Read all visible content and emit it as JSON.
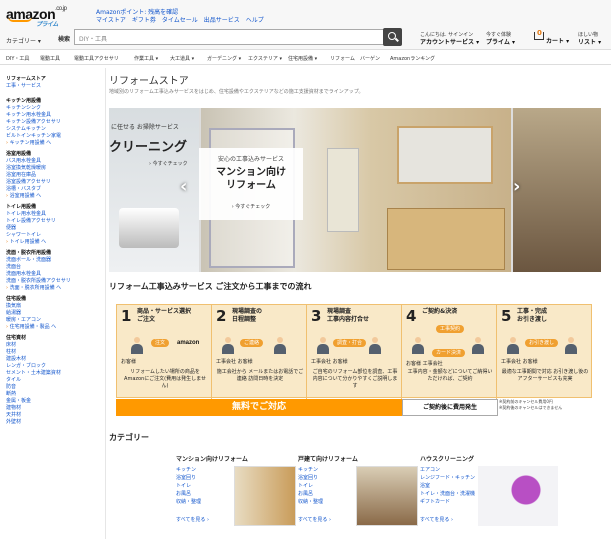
{
  "header": {
    "logo": "amazon",
    "logo_suffix": ".co.jp",
    "prime": "プライム",
    "promo": "Amazonポイント: 残高を確認",
    "toplinks": [
      "マイストア",
      "ギフト券",
      "タイムセール",
      "出品サービス",
      "ヘルプ"
    ],
    "category_btn": "カテゴリー ▾",
    "search_label": "検索",
    "search_placeholder": "DIY・工具",
    "account_small": "こんにちは. サインイン",
    "account_big": "アカウントサービス ▾",
    "prime_small": "今すぐ体験",
    "prime_big": "プライム ▾",
    "cart_count": "0",
    "cart": "カート ▾",
    "wishlist_small": "ほしい物",
    "wishlist_big": "リスト ▾"
  },
  "nav": [
    "DIY・工具",
    "電動工具",
    "電動工具アクセサリ",
    "作業工具 ▾",
    "大工道具 ▾",
    "ガーデニング ▾",
    "エクステリア ▾",
    "住宅用設備 ▾",
    "リフォーム",
    "バーゲン",
    "Amazonランキング"
  ],
  "sidebar": [
    {
      "head": "リフォームストア",
      "items": [
        "工事・サービス"
      ],
      "more": ""
    },
    {
      "head": "キッチン用設備",
      "items": [
        "キッチンシンク",
        "キッチン用水栓金具",
        "キッチン設備アクセサリ",
        "システムキッチン",
        "ビルトインキッチン家電"
      ],
      "more": "キッチン用設備 へ"
    },
    {
      "head": "浴室用設備",
      "items": [
        "バス用水栓金具",
        "浴室換気乾燥暖房",
        "浴室用在庫品",
        "浴室設備アクセサリ",
        "浴槽・バスタブ"
      ],
      "more": "浴室用設備 へ"
    },
    {
      "head": "トイレ用設備",
      "items": [
        "トイレ用水栓金具",
        "トイレ設備アクセサリ",
        "便器",
        "シャワートイレ"
      ],
      "more": "トイレ用設備 へ"
    },
    {
      "head": "洗面・脱衣所用設備",
      "items": [
        "洗面ボール・洗面器",
        "洗面台",
        "洗面用水栓金具",
        "洗面・脱衣所設備アクセサリ"
      ],
      "more": "洗面・脱衣所用設備 へ"
    },
    {
      "head": "住宅設備",
      "items": [
        "換気扇",
        "給湯器",
        "暖房・エアコン"
      ],
      "more": "住宅用設備・製品 へ"
    },
    {
      "head": "住宅資材",
      "items": [
        "床材",
        "柱材",
        "建設木材",
        "レンガ・ブロック",
        "セメント・土木建築資材",
        "タイル",
        "防音",
        "断熱",
        "金属・板金",
        "建物材",
        "天井材",
        "外壁材"
      ],
      "more": ""
    }
  ],
  "page": {
    "title": "リフォームストア",
    "desc": "地域別のリフォーム工事込みサービスをはじめ、住宅設備やエクステリアなどの施工支援資材までラインアップ。"
  },
  "banner": {
    "left_small": "に任せる お掃除サービス",
    "left_big": "クリーニング",
    "left_link": "› 今すぐチェック",
    "center_small": "安心の工事込みサービス",
    "center_big1": "マンション向け",
    "center_big2": "リフォーム",
    "center_link": "› 今すぐチェック"
  },
  "flow": {
    "title": "リフォーム工事込みサービス ご注文から工事までの流れ",
    "steps": [
      {
        "num": "1",
        "title": "商品・サービス選択",
        "title2": "ご注文",
        "who": "お客様",
        "pill": "注文",
        "body": "リフォームしたい場所の商品をAmazonにご注文(費用は発生しません)"
      },
      {
        "num": "2",
        "title": "現場調査の",
        "title2": "日程調整",
        "who": "工事会社      お客様",
        "pill": "ご連絡",
        "body": "施工会社から メールまたはお電話でご連絡 訪問日時を決定"
      },
      {
        "num": "3",
        "title": "現場調査",
        "title2": "工事内容打合せ",
        "who": "工事会社      お客様",
        "pill": "調査・打合",
        "body": "ご自宅のリフォーム部位を調査、工事内容について分かりやすくご説明します"
      },
      {
        "num": "4",
        "title": "ご契約&決済",
        "title2": "",
        "who": "お客様       工事会社",
        "pill": "工事契約",
        "body": "工事内容・金額などについてご納得いただければ、ご契約"
      },
      {
        "num": "5",
        "title": "工事・完成",
        "title2": "お引き渡し",
        "who": "工事会社      お客様",
        "pill": "お引き渡し",
        "body": "最適な工事期間で対応 お引き渡し後の アフターサービスも充実"
      }
    ],
    "free": "無料でご対応",
    "paid": "ご契約後に費用発生",
    "paid_note1": "※契約前のキャンセル費用0円",
    "paid_note2": "※契約後のキャンセルはできません",
    "amazon": "amazon",
    "card_pill": "カード決済"
  },
  "categories": {
    "title": "カテゴリー",
    "items": [
      {
        "title": "マンション向けリフォーム",
        "links": [
          "キッチン",
          "浴室回り",
          "トイレ",
          "お風呂",
          "収納・整理"
        ],
        "more": "すべてを見る ›"
      },
      {
        "title": "戸建て向けリフォーム",
        "links": [
          "キッチン",
          "浴室回り",
          "トイレ",
          "お風呂",
          "収納・整理"
        ],
        "more": "すべてを見る ›"
      },
      {
        "title": "ハウスクリーニング",
        "links": [
          "エアコン",
          "レンジフード・キッチン",
          "浴室",
          "トイレ・洗面台・洗濯機",
          "ギフトカード"
        ],
        "more": "すべてを見る ›"
      }
    ]
  },
  "colors": {
    "accent": "#f90",
    "link": "#1155cc",
    "flow_bg": "#f9e9c8"
  }
}
